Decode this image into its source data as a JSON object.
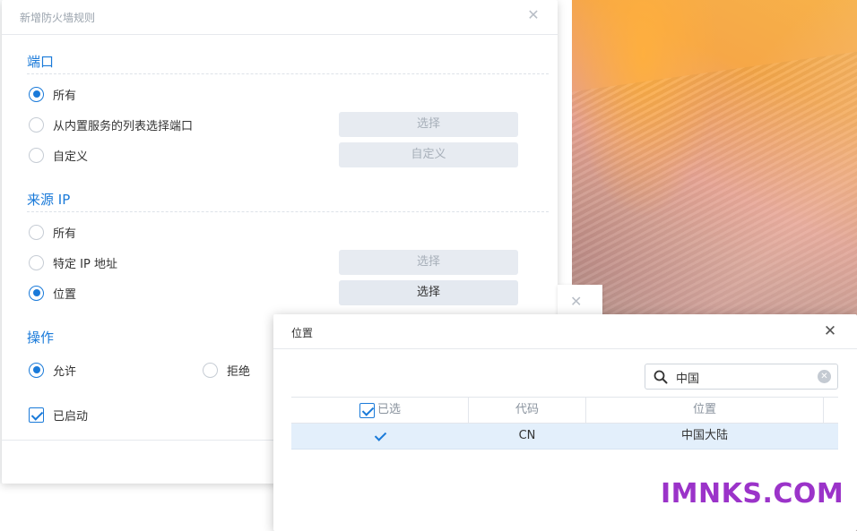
{
  "dialog": {
    "title": "新增防火墙规则",
    "close_icon": "close-icon",
    "port_section": {
      "title": "端口",
      "options": [
        {
          "label": "所有",
          "selected": true
        },
        {
          "label": "从内置服务的列表选择端口",
          "selected": false,
          "button": "选择"
        },
        {
          "label": "自定义",
          "selected": false,
          "button": "自定义"
        }
      ]
    },
    "source_section": {
      "title": "来源 IP",
      "options": [
        {
          "label": "所有",
          "selected": false
        },
        {
          "label": "特定 IP 地址",
          "selected": false,
          "button": "选择"
        },
        {
          "label": "位置",
          "selected": true,
          "button": "选择"
        }
      ]
    },
    "action_section": {
      "title": "操作",
      "allow_label": "允许",
      "deny_label": "拒绝",
      "selected": "allow"
    },
    "enabled_label": "已启动",
    "enabled": true
  },
  "location_popup": {
    "title": "位置",
    "close_icon": "close-icon",
    "search": {
      "value": "中国",
      "icon": "search-icon",
      "clear_icon": "clear-icon"
    },
    "columns": [
      "已选",
      "代码",
      "位置"
    ],
    "rows": [
      {
        "selected": true,
        "code": "CN",
        "location": "中国大陆"
      }
    ]
  },
  "watermark": "IMNKS.COM",
  "colors": {
    "accent": "#1a7ad9",
    "row_highlight": "#e3effb",
    "watermark": "#9b33c9"
  }
}
